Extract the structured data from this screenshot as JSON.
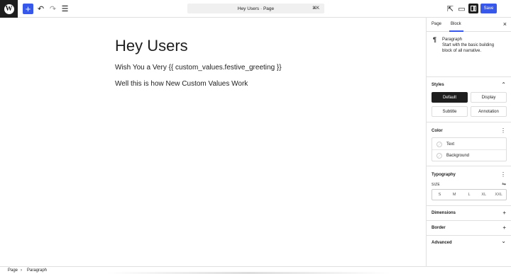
{
  "toolbar": {
    "logo": "W",
    "add_icon": "+",
    "undo_icon": "↶",
    "redo_icon": "↷",
    "list_view_icon": "☰",
    "command_text": "Hey Users · Page",
    "command_shortcut": "⌘K",
    "view_icon": "⇱",
    "preview_icon": "▭",
    "save_label": "Save"
  },
  "canvas": {
    "heading": "Hey Users",
    "paragraphs": [
      "Wish You a Very {{ custom_values.festive_greeting }}",
      "Well this is how New Custom Values Work"
    ]
  },
  "sidebar": {
    "tabs": {
      "page": "Page",
      "block": "Block"
    },
    "close_icon": "×",
    "block": {
      "icon": "¶",
      "name": "Paragraph",
      "description": "Start with the basic building block of all narrative."
    },
    "styles": {
      "title": "Styles",
      "toggle_icon": "⌃",
      "options": [
        "Default",
        "Display",
        "Subtitle",
        "Annotation"
      ],
      "active": "Default"
    },
    "color": {
      "title": "Color",
      "menu_icon": "⋮",
      "items": [
        "Text",
        "Background"
      ]
    },
    "typography": {
      "title": "Typography",
      "menu_icon": "⋮",
      "size_label": "SIZE",
      "size_icon": "⇋",
      "sizes": [
        "S",
        "M",
        "L",
        "XL",
        "XXL"
      ]
    },
    "dimensions": {
      "title": "Dimensions",
      "icon": "+"
    },
    "border": {
      "title": "Border",
      "icon": "+"
    },
    "advanced": {
      "title": "Advanced",
      "icon": "⌄"
    }
  },
  "breadcrumb": {
    "items": [
      "Page",
      "Paragraph"
    ],
    "separator": "›"
  },
  "colors": {
    "accent": "#3858e9",
    "dark": "#1e1e1e"
  }
}
